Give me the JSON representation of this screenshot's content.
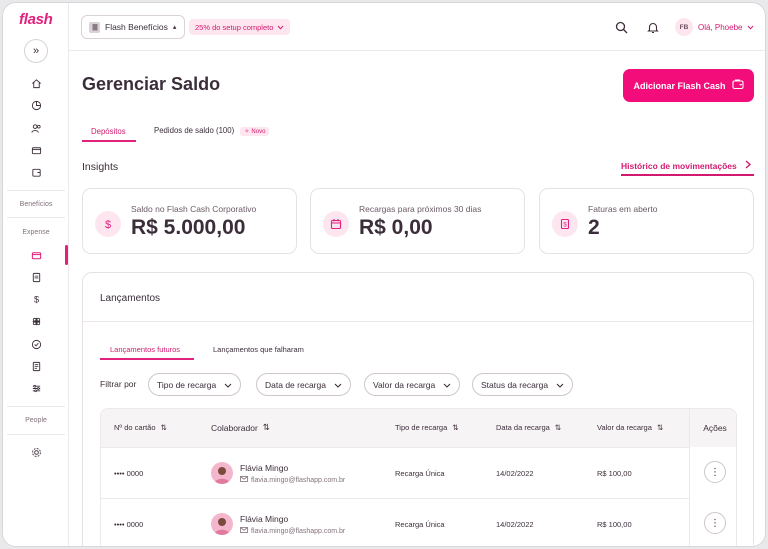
{
  "sidebar": {
    "logo": "flash",
    "collapse_icon": "»",
    "sections": [
      "Benefícios",
      "Expense",
      "People"
    ]
  },
  "topbar": {
    "company": "Flash Benefícios",
    "setup_progress": "25% do setup completo",
    "user_initials": "FB",
    "user_greeting": "Olá, Phoebe"
  },
  "page": {
    "title": "Gerenciar Saldo",
    "primary_action": "Adicionar Flash Cash",
    "tabs": [
      {
        "label": "Depósitos",
        "active": true
      },
      {
        "label": "Pedidos de saldo (100)",
        "active": false,
        "badge": "Novo"
      }
    ]
  },
  "insights": {
    "title": "Insights",
    "history_link": "Histórico de movimentações",
    "cards": [
      {
        "label": "Saldo no Flash Cash Corporativo",
        "value": "R$ 5.000,00",
        "icon": "dollar-icon"
      },
      {
        "label": "Recargas para próximos 30 dias",
        "value": "R$ 0,00",
        "icon": "calendar-icon"
      },
      {
        "label": "Faturas em aberto",
        "value": "2",
        "icon": "invoice-icon"
      }
    ]
  },
  "launches": {
    "title": "Lançamentos",
    "subtabs": [
      "Lançamentos futuros",
      "Lançamentos que falharam"
    ],
    "filter_label": "Filtrar por",
    "filters": [
      "Tipo  de recarga",
      "Data de recarga",
      "Valor da recarga",
      "Status da recarga"
    ],
    "columns": [
      "Nº do cartão",
      "Colaborador",
      "Tipo de recarga",
      "Data da recarga",
      "Valor da recarga",
      "Ações"
    ],
    "rows": [
      {
        "card": "•••• 0000",
        "name": "Flávia Mingo",
        "email": "flavia.mingo@flashapp.com.br",
        "type": "Recarga Única",
        "date": "14/02/2022",
        "value": "R$ 100,00"
      },
      {
        "card": "•••• 0000",
        "name": "Flávia Mingo",
        "email": "flavia.mingo@flashapp.com.br",
        "type": "Recarga Única",
        "date": "14/02/2022",
        "value": "R$ 100,00"
      }
    ]
  },
  "colors": {
    "accent": "#f20d7a",
    "accent_text": "#d3196f",
    "accent_soft": "#fde6f0",
    "text": "#3b2e3a"
  }
}
